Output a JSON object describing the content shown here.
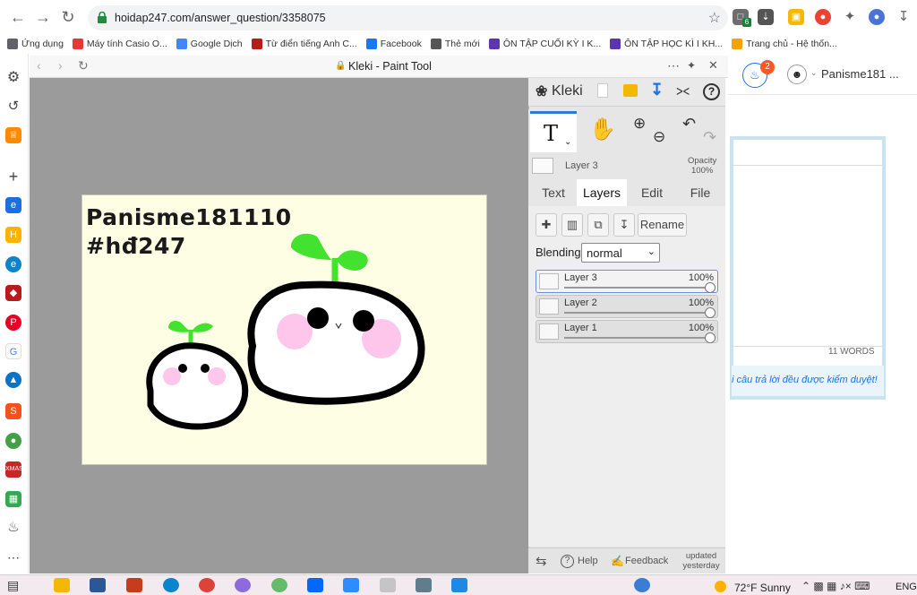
{
  "browser": {
    "url": "hoidap247.com/answer_question/3358075",
    "bookmarks": [
      {
        "label": "Ứng dụng",
        "color": "#5f6368"
      },
      {
        "label": "Máy tính Casio O...",
        "color": "#e53935"
      },
      {
        "label": "Google Dịch",
        "color": "#4285f4"
      },
      {
        "label": "Từ điển tiếng Anh C...",
        "color": "#b71c1c"
      },
      {
        "label": "Facebook",
        "color": "#1877f2"
      },
      {
        "label": "Thẻ mới",
        "color": "#555555"
      },
      {
        "label": "ÔN TẬP CUỐI KỲ I K...",
        "color": "#5e35b1"
      },
      {
        "label": "ÔN TẬP HỌC KÌ I KH...",
        "color": "#5e35b1"
      },
      {
        "label": "Trang chủ - Hệ thốn...",
        "color": "#f4a300"
      }
    ],
    "extension_badge": "6"
  },
  "kleki": {
    "window_title": "Kleki - Paint Tool",
    "brand": "Kleki",
    "layer_current": "Layer 3",
    "opacity_label": "Opacity",
    "opacity_value": "100%",
    "tabs": [
      "Text",
      "Layers",
      "Edit",
      "File"
    ],
    "active_tab": "Layers",
    "rename_label": "Rename",
    "blending_label": "Blending",
    "blending_value": "normal",
    "layers": [
      {
        "name": "Layer 3",
        "opacity": "100%",
        "selected": true
      },
      {
        "name": "Layer 2",
        "opacity": "100%",
        "selected": false
      },
      {
        "name": "Layer 1",
        "opacity": "100%",
        "selected": false
      }
    ],
    "footer": {
      "help": "Help",
      "feedback": "Feedback",
      "updated": "updated yesterday"
    },
    "canvas_text": [
      "Panisme181110",
      "#hđ247"
    ]
  },
  "page": {
    "notif_count": "2",
    "username": "Panisme181 ...",
    "word_count": "11 WORDS",
    "notice": "i câu trả lời đều được kiểm duyệt!"
  },
  "taskbar": {
    "weather": "72°F  Sunny",
    "lang": "ENG"
  }
}
